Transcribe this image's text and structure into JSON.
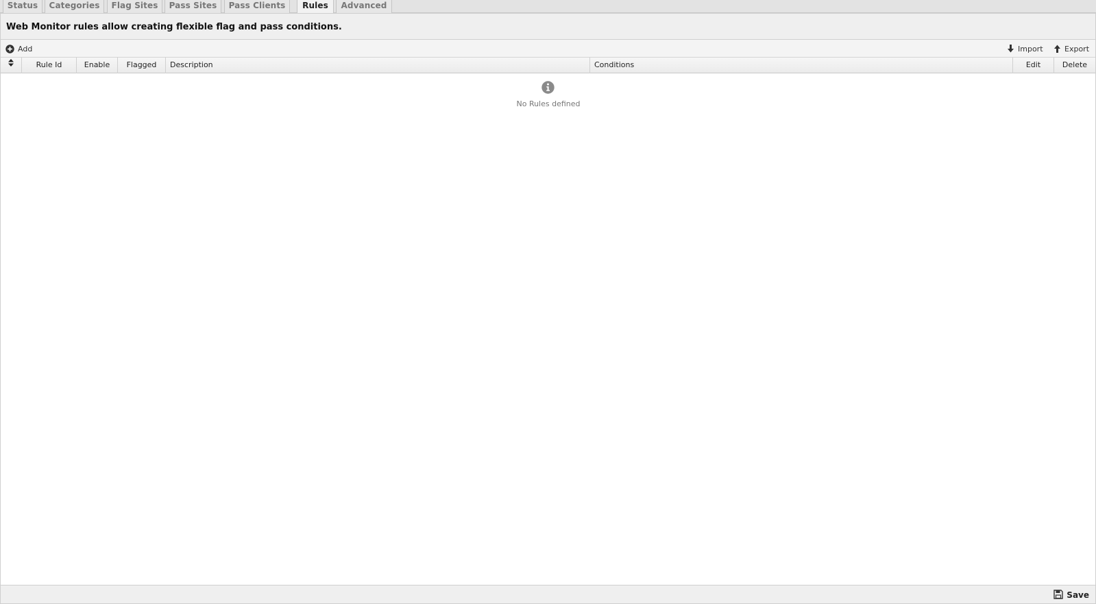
{
  "tabs": [
    {
      "label": "Status",
      "active": false
    },
    {
      "label": "Categories",
      "active": false
    },
    {
      "label": "Flag Sites",
      "active": false
    },
    {
      "label": "Pass Sites",
      "active": false
    },
    {
      "label": "Pass Clients",
      "active": false
    },
    {
      "label": "Rules",
      "active": true
    },
    {
      "label": "Advanced",
      "active": false
    }
  ],
  "description": "Web Monitor rules allow creating flexible flag and pass conditions.",
  "toolbar": {
    "add_label": "Add",
    "import_label": "Import",
    "export_label": "Export"
  },
  "grid": {
    "columns": [
      "Rule Id",
      "Enable",
      "Flagged",
      "Description",
      "Conditions",
      "Edit",
      "Delete"
    ],
    "rows": [],
    "empty_text": "No Rules defined"
  },
  "footer": {
    "save_label": "Save"
  },
  "icons": {
    "add": "plus-circle-icon",
    "import": "arrow-down-icon",
    "export": "arrow-up-icon",
    "reorder": "sort-icon",
    "empty": "info-icon",
    "save": "floppy-disk-icon"
  },
  "colors": {
    "tab_bg": "#e6e6e6",
    "tab_active_bg": "#f2f2f2",
    "empty_icon": "#8a8a8a"
  }
}
